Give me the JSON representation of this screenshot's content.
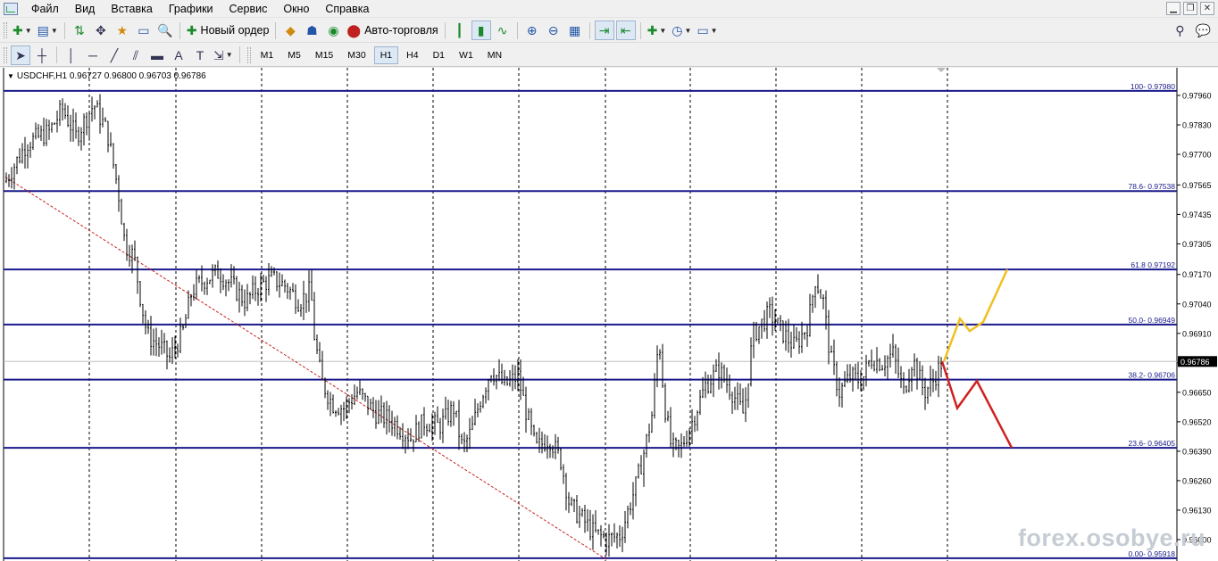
{
  "menu": [
    "Файл",
    "Вид",
    "Вставка",
    "Графики",
    "Сервис",
    "Окно",
    "Справка"
  ],
  "toolbar": {
    "new_order_label": "Новый ордер",
    "autotrade_label": "Авто-торговля"
  },
  "timeframes": [
    "M1",
    "M5",
    "M15",
    "M30",
    "H1",
    "H4",
    "D1",
    "W1",
    "MN"
  ],
  "active_timeframe": "H1",
  "chart": {
    "symbol_info": "USDCHF,H1  0.96727 0.96800 0.96703 0.96786",
    "current_price": "0.96786",
    "price_axis": [
      "0.97960",
      "0.97830",
      "0.97700",
      "0.97565",
      "0.97435",
      "0.97305",
      "0.97170",
      "0.97040",
      "0.96910",
      "0.96780",
      "0.96650",
      "0.96520",
      "0.96390",
      "0.96260",
      "0.96130",
      "0.96000"
    ],
    "fib_levels": [
      {
        "label": "100- 0.97980",
        "price": 0.9798
      },
      {
        "label": "78.6- 0.97538",
        "price": 0.97538
      },
      {
        "label": "61.8 0.97192",
        "price": 0.97192
      },
      {
        "label": "50.0- 0.96949",
        "price": 0.96949
      },
      {
        "label": "38.2- 0.96706",
        "price": 0.96706
      },
      {
        "label": "23.6- 0.96405",
        "price": 0.96405
      },
      {
        "label": "0.00- 0.95918",
        "price": 0.95918
      }
    ],
    "colors": {
      "bars": "#000000",
      "fib": "#1a1a8c",
      "trendline": "#c82020",
      "bullish_scenario": "#f0c020",
      "bearish_scenario": "#d02020",
      "grid": "#000000"
    },
    "watermark": "forex.osobye.ru"
  }
}
